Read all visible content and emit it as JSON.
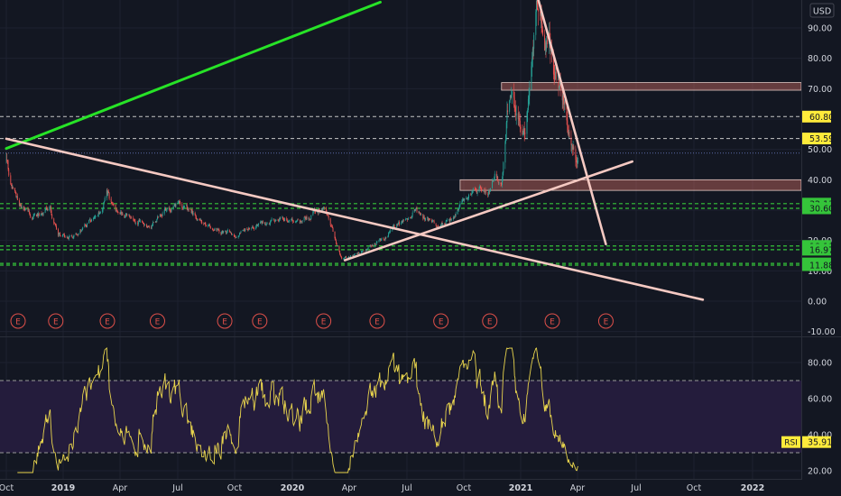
{
  "currency_label": "USD",
  "rsi_indicator_label": "RSI",
  "earnings_marker_label": "E",
  "colors": {
    "background": "#131722",
    "grid": "#1e2230",
    "axis_text": "#d1d4dc",
    "candle_up": "#26a69a",
    "candle_down": "#ef5350",
    "rsi_line": "#e8d44d",
    "rsi_band_fill": "#241c3c",
    "rsi_band_border": "#9a9a9a",
    "support_line": "#4caf50",
    "support_label_bg": "#35c43a",
    "resistance_label_bg": "#ffeb3b",
    "resistance_line": "#c8c8c8",
    "trendline_green": "#27e327",
    "trendline_pink": "#f5c9c2",
    "zone_fill": "#c96a62",
    "earnings_marker": "#e0504a"
  },
  "chart_data": {
    "type": "candlestick",
    "price_axis": {
      "range": [
        -10,
        100
      ],
      "ticks": [
        "-10.00",
        "0.00",
        "10.00",
        "20.00",
        "30.00",
        "40.00",
        "50.00",
        "60.00",
        "70.00",
        "80.00",
        "90.00"
      ],
      "ticks_visible": [
        "-10.00",
        "0.00",
        "10.00",
        "20.00",
        "40.00",
        "50.00",
        "70.00",
        "80.00",
        "90.00"
      ],
      "horizontal_levels": [
        {
          "value": 60.8,
          "label": "60.80",
          "style": "resistance"
        },
        {
          "value": 53.59,
          "label": "53.59",
          "style": "resistance"
        },
        {
          "value": 48.8,
          "label": "",
          "style": "dotted"
        },
        {
          "value": 32.13,
          "label": "32.13",
          "style": "support"
        },
        {
          "value": 30.6,
          "label": "30.60",
          "style": "support"
        },
        {
          "value": 18.19,
          "label": "18.19",
          "style": "support"
        },
        {
          "value": 16.97,
          "label": "16.97",
          "style": "support"
        },
        {
          "value": 12.44,
          "label": "12.44",
          "style": "support"
        },
        {
          "value": 11.88,
          "label": "11.88",
          "style": "support"
        }
      ],
      "zones": [
        {
          "name": "upper-zone",
          "from": "2020-12-01",
          "to": "2022-04-15",
          "low": 69.5,
          "high": 72.0
        },
        {
          "name": "lower-zone",
          "from": "2020-09-25",
          "to": "2022-04-15",
          "low": 36.5,
          "high": 40.0
        }
      ]
    },
    "time_axis": {
      "range": [
        "2018-10-01",
        "2022-05-01"
      ],
      "ticks": [
        {
          "date": "2018-10-01",
          "label": "Oct"
        },
        {
          "date": "2019-01-01",
          "label": "2019"
        },
        {
          "date": "2019-04-01",
          "label": "Apr"
        },
        {
          "date": "2019-07-01",
          "label": "Jul"
        },
        {
          "date": "2019-10-01",
          "label": "Oct"
        },
        {
          "date": "2020-01-01",
          "label": "2020"
        },
        {
          "date": "2020-04-01",
          "label": "Apr"
        },
        {
          "date": "2020-07-01",
          "label": "Jul"
        },
        {
          "date": "2020-10-01",
          "label": "Oct"
        },
        {
          "date": "2021-01-01",
          "label": "2021"
        },
        {
          "date": "2021-04-01",
          "label": "Apr"
        },
        {
          "date": "2021-07-01",
          "label": "Jul"
        },
        {
          "date": "2021-10-01",
          "label": "Oct"
        },
        {
          "date": "2022-01-01",
          "label": "2022"
        }
      ]
    },
    "price_series": {
      "name": "",
      "close_keypoints": [
        [
          "2018-10-01",
          46
        ],
        [
          "2018-10-12",
          36
        ],
        [
          "2018-10-25",
          31
        ],
        [
          "2018-11-15",
          28
        ],
        [
          "2018-12-10",
          31
        ],
        [
          "2018-12-24",
          22
        ],
        [
          "2019-01-15",
          21
        ],
        [
          "2019-02-15",
          27
        ],
        [
          "2019-03-05",
          31
        ],
        [
          "2019-03-10",
          37
        ],
        [
          "2019-03-25",
          29
        ],
        [
          "2019-04-20",
          27
        ],
        [
          "2019-05-20",
          25
        ],
        [
          "2019-06-10",
          30
        ],
        [
          "2019-07-05",
          32
        ],
        [
          "2019-07-25",
          29
        ],
        [
          "2019-08-15",
          25
        ],
        [
          "2019-09-10",
          23
        ],
        [
          "2019-10-05",
          22
        ],
        [
          "2019-10-25",
          24
        ],
        [
          "2019-11-20",
          26
        ],
        [
          "2019-12-15",
          28
        ],
        [
          "2020-01-15",
          26
        ],
        [
          "2020-02-10",
          30
        ],
        [
          "2020-02-22",
          31
        ],
        [
          "2020-03-10",
          20
        ],
        [
          "2020-03-20",
          14
        ],
        [
          "2020-04-05",
          15
        ],
        [
          "2020-04-25",
          17
        ],
        [
          "2020-05-20",
          20
        ],
        [
          "2020-06-10",
          24
        ],
        [
          "2020-06-30",
          27
        ],
        [
          "2020-07-15",
          30
        ],
        [
          "2020-08-01",
          27
        ],
        [
          "2020-08-20",
          25
        ],
        [
          "2020-09-10",
          27
        ],
        [
          "2020-09-25",
          31
        ],
        [
          "2020-10-10",
          35
        ],
        [
          "2020-10-25",
          37
        ],
        [
          "2020-11-10",
          36
        ],
        [
          "2020-11-20",
          41
        ],
        [
          "2020-12-01",
          39
        ],
        [
          "2020-12-05",
          48
        ],
        [
          "2020-12-10",
          62
        ],
        [
          "2020-12-18",
          71
        ],
        [
          "2020-12-25",
          62
        ],
        [
          "2021-01-08",
          56
        ],
        [
          "2021-01-15",
          72
        ],
        [
          "2021-01-22",
          88
        ],
        [
          "2021-01-27",
          99
        ],
        [
          "2021-02-01",
          92
        ],
        [
          "2021-02-08",
          84
        ],
        [
          "2021-02-15",
          87
        ],
        [
          "2021-02-22",
          76
        ],
        [
          "2021-03-01",
          73
        ],
        [
          "2021-03-08",
          68
        ],
        [
          "2021-03-15",
          60
        ],
        [
          "2021-03-20",
          53
        ],
        [
          "2021-03-28",
          48
        ],
        [
          "2021-04-02",
          45
        ]
      ]
    },
    "trendlines": [
      {
        "name": "green-uptrend",
        "color_key": "trendline_green",
        "points": [
          [
            "2018-10-01",
            50.3
          ],
          [
            "2020-05-20",
            98.5
          ]
        ]
      },
      {
        "name": "pink-descending",
        "color_key": "trendline_pink",
        "points": [
          [
            "2018-10-01",
            53.5
          ],
          [
            "2021-10-15",
            0.5
          ]
        ]
      },
      {
        "name": "pink-ascending",
        "color_key": "trendline_pink",
        "points": [
          [
            "2020-03-25",
            13.5
          ],
          [
            "2021-06-25",
            46.0
          ]
        ]
      },
      {
        "name": "pink-steep",
        "color_key": "trendline_pink",
        "points": [
          [
            "2021-01-28",
            100
          ],
          [
            "2021-05-15",
            18.8
          ]
        ]
      }
    ],
    "earnings_events": [
      "2018-10-20",
      "2018-12-20",
      "2019-03-12",
      "2019-05-30",
      "2019-09-15",
      "2019-11-10",
      "2020-02-20",
      "2020-05-15",
      "2020-08-25",
      "2020-11-12",
      "2021-02-20",
      "2021-05-15"
    ],
    "rsi": {
      "axis_range": [
        18,
        90
      ],
      "ticks": [
        "20.00",
        "40.00",
        "60.00",
        "80.00"
      ],
      "overbought": 70,
      "oversold": 30,
      "current_label": "35.91",
      "current_value": 35.91
    }
  }
}
